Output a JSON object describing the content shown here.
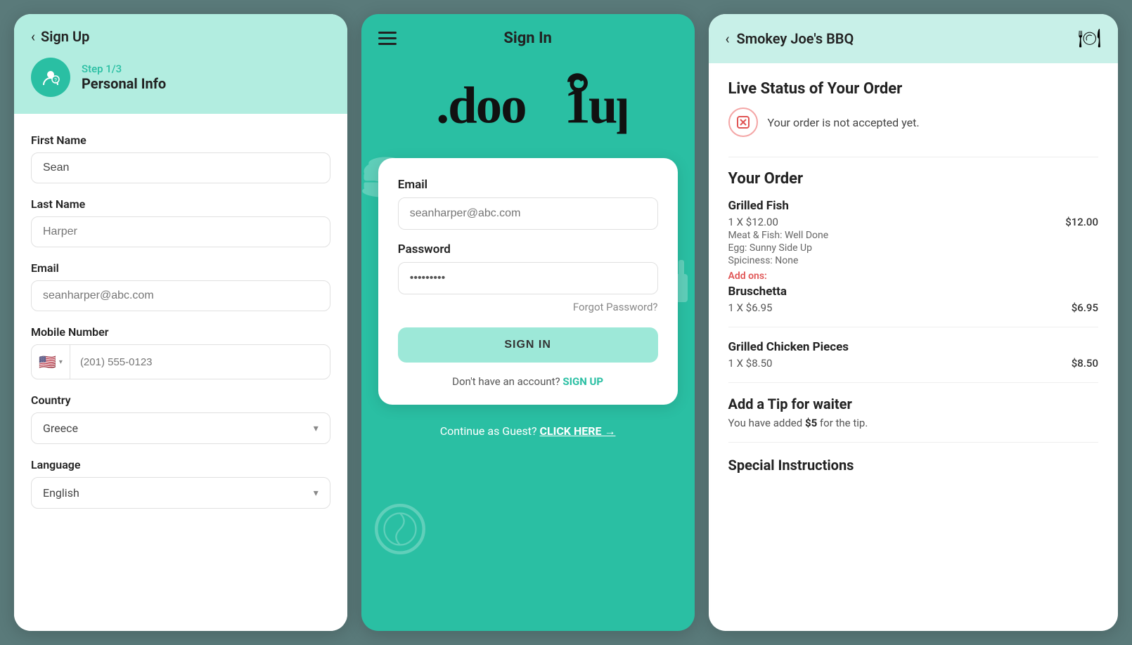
{
  "signup": {
    "back_label": "Sign Up",
    "step_number": "Step 1/3",
    "step_title": "Personal Info",
    "fields": {
      "first_name_label": "First Name",
      "first_name_value": "Sean",
      "last_name_label": "Last Name",
      "last_name_placeholder": "Harper",
      "email_label": "Email",
      "email_placeholder": "seanharper@abc.com",
      "mobile_label": "Mobile Number",
      "mobile_placeholder": "(201) 555-0123",
      "country_label": "Country",
      "country_value": "Greece",
      "language_label": "Language",
      "language_value": "English"
    }
  },
  "signin": {
    "menu_icon": "≡",
    "title": "Sign In",
    "logo_text": ".doo1up",
    "email_label": "Email",
    "email_placeholder": "seanharper@abc.com",
    "password_label": "Password",
    "password_value": "••••••••",
    "forgot_label": "Forgot Password?",
    "signin_button": "SIGN IN",
    "no_account_text": "Don't have an account?",
    "signup_link": "SIGN UP",
    "guest_text": "Continue as Guest?",
    "guest_link": "CLICK HERE →"
  },
  "order": {
    "back_arrow": "‹",
    "restaurant_name": "Smokey Joe's BBQ",
    "dish_icon": "🍽",
    "live_status_title": "Live Status of Your Order",
    "status_text": "Your order is not accepted yet.",
    "your_order_title": "Your Order",
    "items": [
      {
        "name": "Grilled Fish",
        "qty": "1 X $12.00",
        "price": "$12.00",
        "meta": [
          "Meat & Fish: Well Done",
          "Egg: Sunny Side Up",
          "Spiciness: None"
        ],
        "addons_label": "Add ons:",
        "addons": [
          {
            "name": "Bruschetta",
            "qty": "1 X $6.95",
            "price": "$6.95"
          }
        ]
      },
      {
        "name": "Grilled Chicken Pieces",
        "qty": "1 X $8.50",
        "price": "$8.50",
        "meta": [],
        "addons_label": "",
        "addons": []
      }
    ],
    "tip_title": "Add a Tip for waiter",
    "tip_desc": "You have added",
    "tip_amount": "$5",
    "tip_suffix": "for the tip.",
    "special_title": "Special Instructions"
  }
}
